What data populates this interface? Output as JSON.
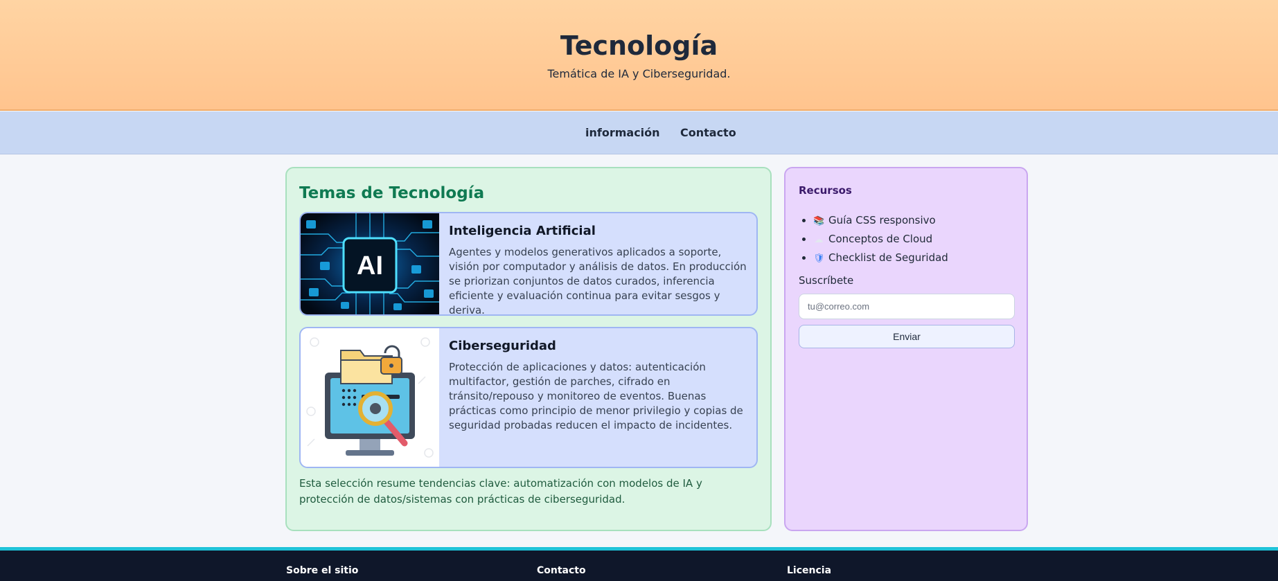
{
  "header": {
    "title": "Tecnología",
    "subtitle": "Temática de IA y Ciberseguridad."
  },
  "nav": {
    "items": [
      {
        "label": "información"
      },
      {
        "label": "Contacto"
      }
    ]
  },
  "main": {
    "title": "Temas de Tecnología",
    "cards": [
      {
        "title": "Inteligencia Artificial",
        "text": "Agentes y modelos generativos aplicados a soporte, visión por computador y análisis de datos. En producción se priorizan conjuntos de datos curados, inferencia eficiente y evaluación continua para evitar sesgos y deriva.",
        "image_icon": "ai-chip-image",
        "image_label": "AI"
      },
      {
        "title": "Ciberseguridad",
        "text": "Protección de aplicaciones y datos: autenticación multifactor, gestión de parches, cifrado en tránsito/repouso y monitoreo de eventos. Buenas prácticas como principio de menor privilegio y copias de seguridad probadas reducen el impacto de incidentes.",
        "image_icon": "security-monitor-image"
      }
    ],
    "summary": "Esta selección resume tendencias clave: automatización con modelos de IA y protección de datos/sistemas con prácticas de ciberseguridad."
  },
  "sidebar": {
    "title": "Recursos",
    "links": [
      {
        "icon": "books-icon",
        "glyph": "📚",
        "label": "Guía CSS responsivo"
      },
      {
        "icon": "cloud-icon",
        "glyph": "☁",
        "label": "Conceptos de Cloud"
      },
      {
        "icon": "shield-icon",
        "glyph": "🛡",
        "label": "Checklist de Seguridad"
      }
    ],
    "subscribe_label": "Suscríbete",
    "email_placeholder": "tu@correo.com",
    "send_label": "Enviar"
  },
  "footer": {
    "about": "Sobre el sitio",
    "contact": "Contacto",
    "license": "Licencia"
  },
  "colors": {
    "header_bg": "#ffc48e",
    "nav_bg": "#c7d7f3",
    "topics_bg": "#dcf5e5",
    "topics_title": "#0f7a52",
    "card_bg": "#d5dffd",
    "sidebar_bg": "#ead6fd",
    "footer_bg": "#0f172a",
    "footer_accent": "#1fc3d8"
  }
}
